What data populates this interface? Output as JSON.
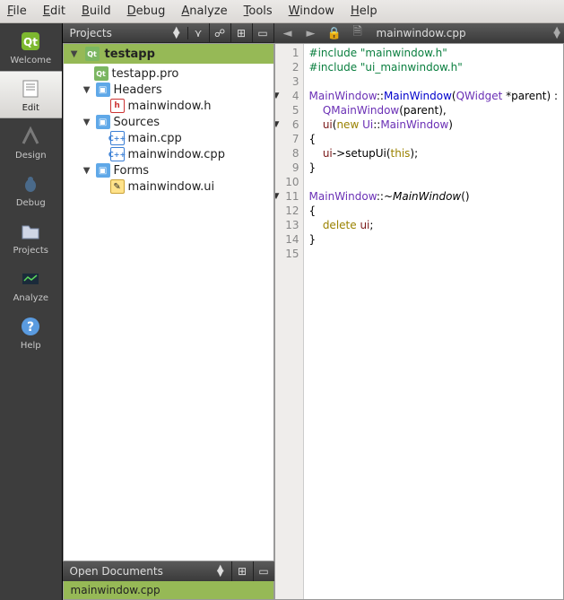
{
  "menu": [
    "File",
    "Edit",
    "Build",
    "Debug",
    "Analyze",
    "Tools",
    "Window",
    "Help"
  ],
  "sidebar": {
    "items": [
      {
        "label": "Welcome"
      },
      {
        "label": "Edit"
      },
      {
        "label": "Design"
      },
      {
        "label": "Debug"
      },
      {
        "label": "Projects"
      },
      {
        "label": "Analyze"
      },
      {
        "label": "Help"
      }
    ]
  },
  "panel": {
    "projects_label": "Projects"
  },
  "project": {
    "name": "testapp",
    "pro_file": "testapp.pro",
    "headers_label": "Headers",
    "headers": [
      "mainwindow.h"
    ],
    "sources_label": "Sources",
    "sources": [
      "main.cpp",
      "mainwindow.cpp"
    ],
    "forms_label": "Forms",
    "forms": [
      "mainwindow.ui"
    ]
  },
  "open_documents": {
    "label": "Open Documents",
    "items": [
      "mainwindow.cpp"
    ]
  },
  "editor": {
    "filename": "mainwindow.cpp",
    "line_count": 15,
    "code": {
      "l1_inc": "#include ",
      "l1_str": "\"mainwindow.h\"",
      "l2_inc": "#include ",
      "l2_str": "\"ui_mainwindow.h\"",
      "l4_a": "MainWindow",
      "l4_b": "::",
      "l4_c": "MainWindow",
      "l4_d": "(",
      "l4_e": "QWidget",
      "l4_f": " *parent) :",
      "l5_a": "QMainWindow",
      "l5_b": "(parent),",
      "l6_a": "ui",
      "l6_b": "(",
      "l6_c": "new",
      "l6_d": " ",
      "l6_e": "Ui",
      "l6_f": "::",
      "l6_g": "MainWindow",
      "l6_h": ")",
      "l7": "{",
      "l8_a": "ui",
      "l8_b": "->setupUi(",
      "l8_c": "this",
      "l8_d": ");",
      "l9": "}",
      "l11_a": "MainWindow",
      "l11_b": "::~",
      "l11_c": "MainWindow",
      "l11_d": "()",
      "l12": "{",
      "l13_a": "delete",
      "l13_b": " ",
      "l13_c": "ui",
      "l13_d": ";",
      "l14": "}"
    }
  }
}
